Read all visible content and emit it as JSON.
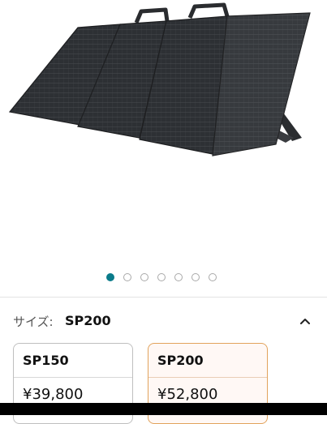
{
  "carousel": {
    "total": 7,
    "active_index": 0
  },
  "size_selector": {
    "label": "サイズ:",
    "selected_value": "SP200",
    "collapse_icon": "chevron-up-icon",
    "options": [
      {
        "name": "SP150",
        "price": "¥39,800",
        "selected": false
      },
      {
        "name": "SP200",
        "price": "¥52,800",
        "selected": true
      }
    ]
  },
  "colors": {
    "accent": "#0a7b8a",
    "selected_border": "#e2a35c"
  }
}
